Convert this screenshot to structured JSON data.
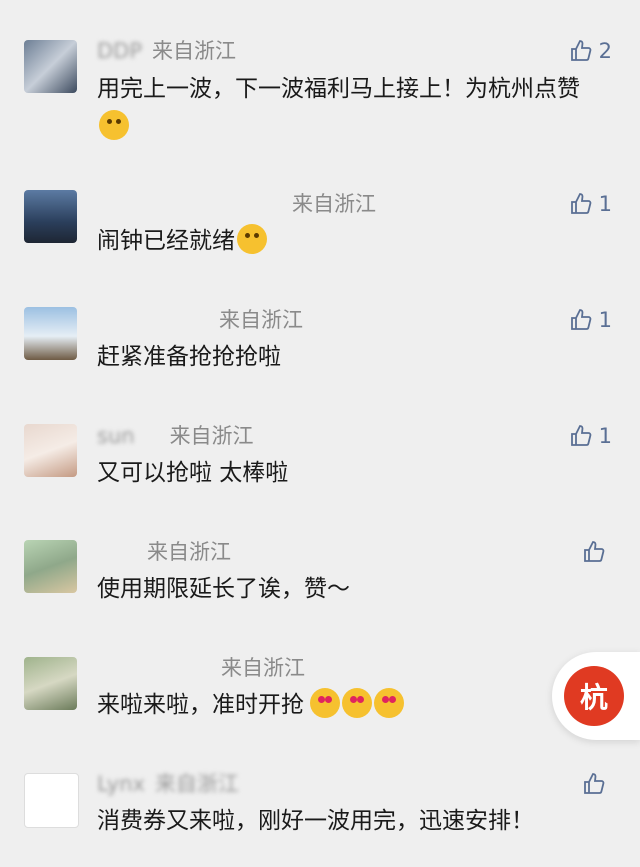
{
  "comments": [
    {
      "name": "DDP",
      "region": "来自浙江",
      "text": "用完上一波，下一波福利马上接上！为杭州点赞",
      "emojis": [
        "grin-icon"
      ],
      "likes": "2"
    },
    {
      "name": "",
      "region": "来自浙江",
      "text": "闹钟已经就绪",
      "emojis": [
        "smile-icon"
      ],
      "likes": "1"
    },
    {
      "name": "",
      "region": "来自浙江",
      "text": "赶紧准备抢抢抢啦",
      "emojis": [],
      "likes": "1"
    },
    {
      "name": "sun",
      "region": "来自浙江",
      "text": "又可以抢啦 太棒啦",
      "emojis": [],
      "likes": "1"
    },
    {
      "name": "",
      "region": "来自浙江",
      "text": "使用期限延长了诶，赞～",
      "emojis": [],
      "likes": ""
    },
    {
      "name": "",
      "region": "来自浙江",
      "text": "来啦来啦，准时开抢",
      "emojis": [
        "heart-eyes-icon",
        "heart-eyes-icon",
        "heart-eyes-icon"
      ],
      "likes": ""
    },
    {
      "name": "Lynx",
      "region": "来自浙江",
      "text": "消费券又来啦，刚好一波用完，迅速安排！",
      "emojis": [],
      "likes": ""
    }
  ],
  "floating_button": {
    "label": "杭"
  },
  "colors": {
    "background": "#efefef",
    "like": "#5a6f94",
    "accent": "#e03a22"
  }
}
